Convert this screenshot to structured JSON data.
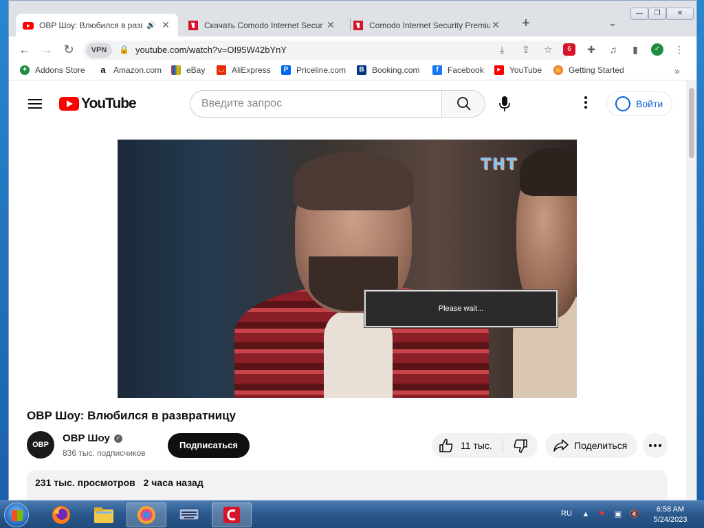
{
  "browser": {
    "tabs": [
      {
        "title": "OBP Шоу: Влюбился в разв",
        "active": true
      },
      {
        "title": "Скачать Comodo Internet Secur",
        "active": false
      },
      {
        "title": "Comodo Internet Security Premiu",
        "active": false
      }
    ],
    "url": "youtube.com/watch?v=OI95W42bYnY",
    "vpn_label": "VPN",
    "bookmarks": [
      {
        "label": "Addons Store"
      },
      {
        "label": "Amazon.com"
      },
      {
        "label": "eBay"
      },
      {
        "label": "AliExpress"
      },
      {
        "label": "Priceline.com"
      },
      {
        "label": "Booking.com"
      },
      {
        "label": "Facebook"
      },
      {
        "label": "YouTube"
      },
      {
        "label": "Getting Started"
      }
    ]
  },
  "youtube": {
    "logo_text": "YouTube",
    "search_placeholder": "Введите запрос",
    "signin_label": "Войти",
    "player": {
      "overlay_text": "Please wait...",
      "watermark": "ТНТ"
    },
    "video": {
      "title": "OBP Шоу: Влюбился в развратницу",
      "channel_name": "OBP Шоу",
      "channel_avatar_text": "OBP",
      "subscribers": "836 тыс. подписчиков",
      "subscribe_label": "Подписаться",
      "likes": "11 тыс.",
      "share_label": "Поделиться",
      "views": "231 тыс. просмотров",
      "published": "2 часа назад"
    }
  },
  "taskbar": {
    "language": "RU",
    "time": "6:58 AM",
    "date": "5/24/2023"
  },
  "colors": {
    "youtube_red": "#ff0000",
    "signin_blue": "#065fd4",
    "taskbar": "#2c5a8e"
  }
}
